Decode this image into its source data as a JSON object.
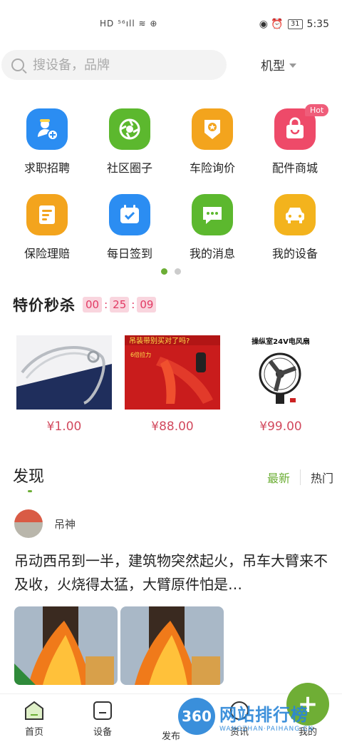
{
  "status_bar": {
    "network": "HD ⁵⁶ıll ≋ ⊕",
    "indicators": "◉ ⏰",
    "battery": "31",
    "time": "5:35"
  },
  "search": {
    "placeholder": "搜设备，品牌",
    "model_select": "机型"
  },
  "grid": [
    {
      "label": "求职招聘",
      "icon": "job-icon",
      "color": "#2b8df2"
    },
    {
      "label": "社区圈子",
      "icon": "community-icon",
      "color": "#5cb82e"
    },
    {
      "label": "车险询价",
      "icon": "insurance-quote-icon",
      "color": "#f3a41d"
    },
    {
      "label": "配件商城",
      "icon": "shop-bag-icon",
      "color": "#ee4a69",
      "badge": "Hot"
    },
    {
      "label": "保险理赔",
      "icon": "claim-doc-icon",
      "color": "#f3a41d"
    },
    {
      "label": "每日签到",
      "icon": "calendar-check-icon",
      "color": "#2b8df2"
    },
    {
      "label": "我的消息",
      "icon": "message-icon",
      "color": "#5cb82e"
    },
    {
      "label": "我的设备",
      "icon": "car-icon",
      "color": "#f3b31d"
    }
  ],
  "flash_sale": {
    "title": "特价秒杀",
    "hours": "00",
    "minutes": "25",
    "seconds": "09"
  },
  "deals": [
    {
      "price": "¥1.00",
      "image": "steel-wire-rope"
    },
    {
      "price": "¥88.00",
      "image": "lifting-sling",
      "caption": "吊装带别买对了吗?",
      "sub": "6倍拉力"
    },
    {
      "price": "¥99.00",
      "image": "fan",
      "caption": "操纵室24V电风扇"
    }
  ],
  "discover": {
    "title": "发现",
    "tab_latest": "最新",
    "tab_hot": "热门"
  },
  "post": {
    "user": "吊神",
    "text": "吊动西吊到一半，建筑物突然起火，吊车大臂来不及收，火烧得太猛，大臂原件怕是…"
  },
  "tabbar": {
    "home": "首页",
    "equipment": "设备",
    "publish": "发布",
    "news": "资讯",
    "mine": "我的"
  },
  "watermark": {
    "logo": "360",
    "main": "网站排行榜",
    "sub": "WANGZHAN·PAIHANG·CN·"
  }
}
